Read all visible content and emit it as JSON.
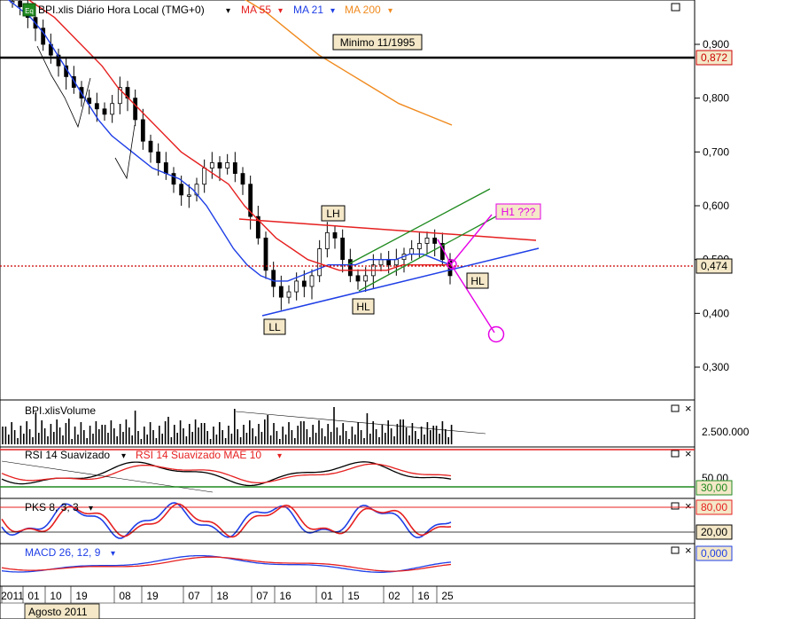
{
  "header": {
    "badge": "Eq",
    "instrument": "BPI.xlis Diário Hora Local (TMG+0)",
    "ma55": "MA 55",
    "ma21": "MA 21",
    "ma200": "MA 200",
    "dropdown_glyph": "▾"
  },
  "colors": {
    "price_bar": "#000000",
    "ma21": "#1f3fe6",
    "ma55": "#e62020",
    "ma200": "#f08a1e",
    "support_level": "#000000",
    "current_level": "#cc0000",
    "resistance_line": "#e62020",
    "support_line": "#1f3fe6",
    "channel": "#1f8a1f",
    "projection": "#e600e6",
    "label_bg": "#f4e8c8",
    "rsi_upper": "#e62020",
    "rsi_lower": "#1f8a1f"
  },
  "annotations": {
    "minimo": "Minimo 11/1995",
    "lh": "LH",
    "ll": "LL",
    "hl1": "HL",
    "hl2": "HL",
    "h1": "H1 ???"
  },
  "price_axis": {
    "ticks": [
      "0,900",
      "0,800",
      "0,700",
      "0,600",
      "0,500",
      "0,400",
      "0,300"
    ],
    "current_tag": "0,474",
    "support_tag": "0,872"
  },
  "volume_panel": {
    "title": "BPI.xlisVolume",
    "axis_label": "2.500.000"
  },
  "rsi_panel": {
    "title": "RSI 14 Suavizado",
    "title2": "RSI 14 Suavizado MAE 10",
    "axis_label": "50,00",
    "level_tag": "30,00"
  },
  "pks_panel": {
    "title": "PKS 8, 3, 3",
    "upper_tag": "80,00",
    "lower_tag": "20,00"
  },
  "macd_panel": {
    "title": "MACD 26, 12, 9",
    "zero_tag": "0,000"
  },
  "window_controls": {
    "restore": "□",
    "close": "×"
  },
  "date_axis": {
    "ticks": [
      "2011",
      "01",
      "10",
      "19",
      "08",
      "19",
      "07",
      "18",
      "07",
      "16",
      "01",
      "15",
      "02",
      "16",
      "25"
    ],
    "month_label": "Agosto 2011"
  },
  "chart_data": {
    "type": "candlestick",
    "ylim": [
      0.25,
      1.0
    ],
    "close_approx": [
      0.98,
      0.97,
      0.95,
      0.93,
      0.9,
      0.88,
      0.86,
      0.84,
      0.82,
      0.8,
      0.79,
      0.78,
      0.77,
      0.79,
      0.82,
      0.8,
      0.76,
      0.72,
      0.7,
      0.68,
      0.66,
      0.64,
      0.62,
      0.62,
      0.64,
      0.67,
      0.68,
      0.67,
      0.68,
      0.66,
      0.64,
      0.58,
      0.54,
      0.48,
      0.45,
      0.43,
      0.44,
      0.46,
      0.45,
      0.47,
      0.52,
      0.55,
      0.54,
      0.5,
      0.47,
      0.46,
      0.47,
      0.49,
      0.5,
      0.49,
      0.5,
      0.51,
      0.52,
      0.53,
      0.54,
      0.53,
      0.5,
      0.47
    ],
    "ma21_approx": [
      0.99,
      0.97,
      0.95,
      0.92,
      0.88,
      0.84,
      0.8,
      0.76,
      0.73,
      0.71,
      0.69,
      0.67,
      0.66,
      0.65,
      0.63,
      0.6,
      0.56,
      0.52,
      0.49,
      0.47,
      0.46,
      0.46,
      0.47,
      0.48,
      0.49,
      0.49,
      0.49,
      0.5,
      0.5,
      0.5,
      0.51,
      0.51,
      0.5,
      0.49
    ],
    "ma55_approx": [
      1.0,
      0.99,
      0.97,
      0.95,
      0.92,
      0.89,
      0.86,
      0.82,
      0.79,
      0.76,
      0.73,
      0.7,
      0.68,
      0.66,
      0.64,
      0.6,
      0.57,
      0.54,
      0.52,
      0.5,
      0.49,
      0.48,
      0.48,
      0.48,
      0.48,
      0.49,
      0.49,
      0.49,
      0.49
    ],
    "ma200_approx": [
      0.99,
      0.96,
      0.92,
      0.88,
      0.85,
      0.82,
      0.79,
      0.77,
      0.75
    ],
    "levels": {
      "support": 0.872,
      "current": 0.474
    }
  }
}
